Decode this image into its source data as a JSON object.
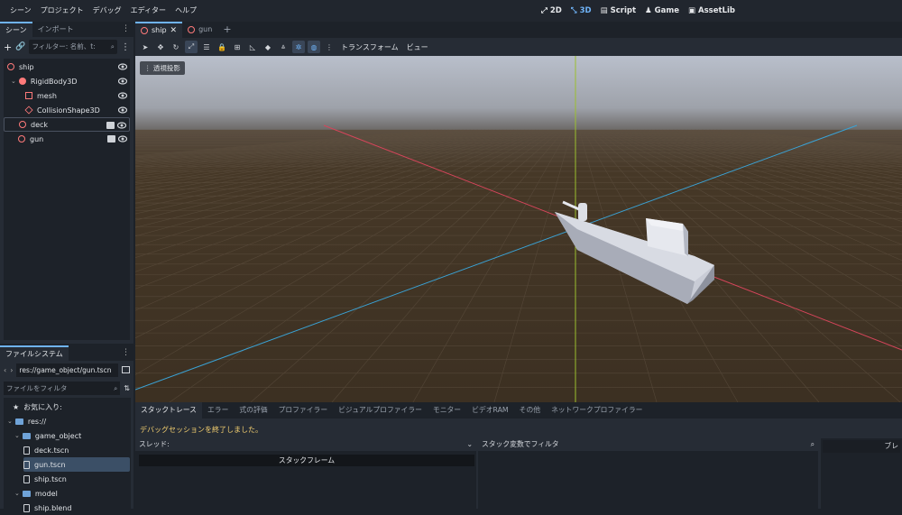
{
  "menu": [
    "シーン",
    "プロジェクト",
    "デバッグ",
    "エディター",
    "ヘルプ"
  ],
  "main_screens": [
    {
      "label": "2D",
      "icon": "2d-icon",
      "active": false
    },
    {
      "label": "3D",
      "icon": "3d-icon",
      "active": true
    },
    {
      "label": "Script",
      "icon": "script-icon",
      "active": false
    },
    {
      "label": "Game",
      "icon": "game-icon",
      "active": false
    },
    {
      "label": "AssetLib",
      "icon": "assetlib-icon",
      "active": false
    }
  ],
  "scene_dock": {
    "tabs": [
      "シーン",
      "インポート"
    ],
    "filter_placeholder": "フィルター: 名前、t:",
    "nodes": [
      {
        "name": "ship",
        "color": "#ff7a7a",
        "indent": 0
      },
      {
        "name": "RigidBody3D",
        "color": "#ff7a7a",
        "indent": 1
      },
      {
        "name": "mesh",
        "color": "#ff7a7a",
        "indent": 2
      },
      {
        "name": "CollisionShape3D",
        "color": "#ff7a7a",
        "indent": 2
      },
      {
        "name": "deck",
        "color": "#ff7a7a",
        "indent": 1
      },
      {
        "name": "gun",
        "color": "#ff7a7a",
        "indent": 1
      }
    ]
  },
  "filesystem": {
    "tab": "ファイルシステム",
    "path": "res://game_object/gun.tscn",
    "filter_placeholder": "ファイルをフィルタ",
    "favorites": "お気に入り:",
    "items": [
      {
        "label": "res://",
        "type": "folder",
        "indent": 0
      },
      {
        "label": "game_object",
        "type": "folder",
        "indent": 1
      },
      {
        "label": "deck.tscn",
        "type": "file",
        "indent": 2
      },
      {
        "label": "gun.tscn",
        "type": "file",
        "indent": 2,
        "selected": true
      },
      {
        "label": "ship.tscn",
        "type": "file",
        "indent": 2
      },
      {
        "label": "model",
        "type": "folder",
        "indent": 1
      },
      {
        "label": "ship.blend",
        "type": "file",
        "indent": 2
      }
    ]
  },
  "scene_tabs": [
    {
      "label": "ship",
      "active": true
    },
    {
      "label": "gun",
      "active": false
    }
  ],
  "toolbar": {
    "transform_label": "トランスフォーム",
    "view_label": "ビュー"
  },
  "viewport": {
    "perspective_label": "透視投影",
    "colors": {
      "sky_top": "#b7bdc9",
      "horizon": "#6d6a68",
      "ground": "#3e3223",
      "x_axis": "#d6455b",
      "z_axis": "#3aa3d6",
      "y_axis": "#9bbf2e",
      "ship": "#c9ccd6"
    }
  },
  "bottom_panel": {
    "tabs": [
      "スタックトレース",
      "エラー",
      "式の評価",
      "プロファイラー",
      "ビジュアルプロファイラー",
      "モニター",
      "ビデオRAM",
      "その他",
      "ネットワークプロファイラー"
    ],
    "message": "デバッグセッションを終了しました。",
    "thread_label": "スレッド:",
    "stack_frame_label": "スタックフレーム",
    "filter_label": "スタック変数でフィルタ",
    "right_button": "ブレ"
  }
}
